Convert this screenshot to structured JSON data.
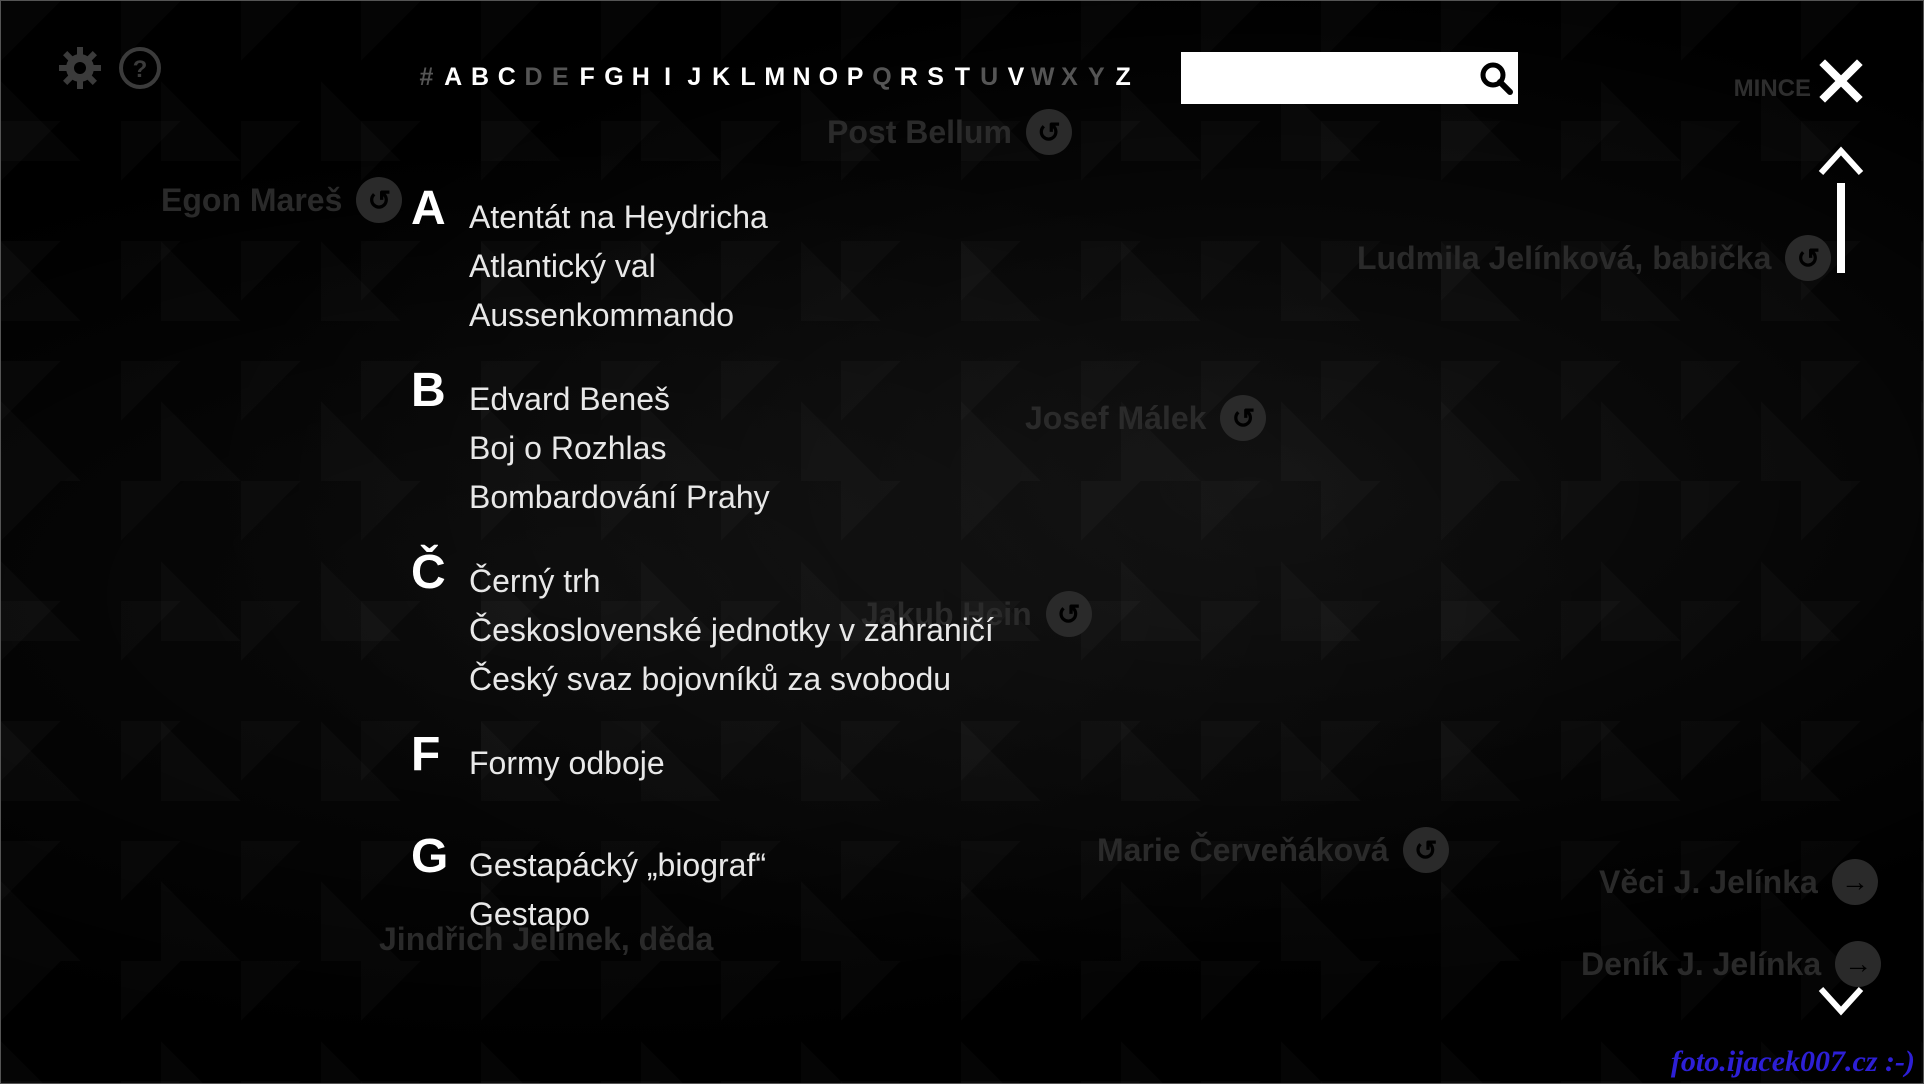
{
  "background_labels": [
    {
      "text": "Post Bellum"
    },
    {
      "text": "Egon Mareš"
    },
    {
      "text": "Ludmila Jelínková, babička"
    },
    {
      "text": "Josef Málek"
    },
    {
      "text": "Jakub Hein"
    },
    {
      "text": "Marie Červeňáková"
    },
    {
      "text": "Věci J. Jelínka"
    },
    {
      "text": "Deník J. Jelínka"
    },
    {
      "text": "Jindřich Jelínek, děda"
    }
  ],
  "tools": {
    "settings_icon": "gear-icon",
    "help_icon": "question-icon"
  },
  "alphabet": [
    {
      "label": "#",
      "enabled": false
    },
    {
      "label": "A",
      "enabled": true
    },
    {
      "label": "B",
      "enabled": true
    },
    {
      "label": "C",
      "enabled": true
    },
    {
      "label": "D",
      "enabled": false
    },
    {
      "label": "E",
      "enabled": false
    },
    {
      "label": "F",
      "enabled": true
    },
    {
      "label": "G",
      "enabled": true
    },
    {
      "label": "H",
      "enabled": true
    },
    {
      "label": "I",
      "enabled": true
    },
    {
      "label": "J",
      "enabled": true
    },
    {
      "label": "K",
      "enabled": true
    },
    {
      "label": "L",
      "enabled": true
    },
    {
      "label": "M",
      "enabled": true
    },
    {
      "label": "N",
      "enabled": true
    },
    {
      "label": "O",
      "enabled": true
    },
    {
      "label": "P",
      "enabled": true
    },
    {
      "label": "Q",
      "enabled": false
    },
    {
      "label": "R",
      "enabled": true
    },
    {
      "label": "S",
      "enabled": true
    },
    {
      "label": "T",
      "enabled": true
    },
    {
      "label": "U",
      "enabled": false
    },
    {
      "label": "V",
      "enabled": true
    },
    {
      "label": "W",
      "enabled": false
    },
    {
      "label": "X",
      "enabled": false
    },
    {
      "label": "Y",
      "enabled": false
    },
    {
      "label": "Z",
      "enabled": true
    }
  ],
  "search": {
    "value": "",
    "placeholder": "",
    "icon": "search-icon"
  },
  "header_right": {
    "mince_label": "MINCE"
  },
  "index": [
    {
      "letter": "A",
      "items": [
        "Atentát na Heydricha",
        "Atlantický val",
        "Aussenkommando"
      ]
    },
    {
      "letter": "B",
      "items": [
        "Edvard Beneš",
        "Boj o Rozhlas",
        "Bombardování Prahy"
      ]
    },
    {
      "letter": "Č",
      "items": [
        "Černý trh",
        "Československé jednotky v zahraničí",
        "Český svaz bojovníků za svobodu"
      ]
    },
    {
      "letter": "F",
      "items": [
        "Formy odboje"
      ]
    },
    {
      "letter": "G",
      "items": [
        "Gestapácký „biograf“",
        "Gestapo"
      ]
    }
  ],
  "watermark": "foto.ijacek007.cz :-)",
  "colors": {
    "background": "#000000",
    "text": "#ffffff",
    "disabled_letter": "#555555",
    "watermark": "#2d1fd6"
  }
}
